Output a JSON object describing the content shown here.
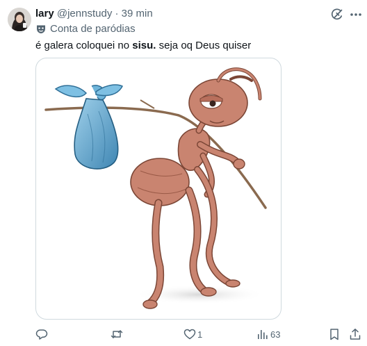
{
  "tweet": {
    "display_name": "lary",
    "handle": "@jennstudy",
    "separator": "·",
    "time": "39 min",
    "parody_label": "Conta de paródias",
    "text_before": "é galera coloquei no ",
    "text_bold": "sisu.",
    "text_after": " seja oq Deus quiser"
  },
  "actions": {
    "reply_count": "",
    "repost_count": "",
    "like_count": "1",
    "views_count": "63"
  },
  "icons": {
    "grok": "grok-icon",
    "more": "more-icon",
    "parody": "parody-mask-icon",
    "reply": "reply-icon",
    "repost": "repost-icon",
    "like": "heart-icon",
    "views": "views-icon",
    "bookmark": "bookmark-icon",
    "share": "share-icon"
  },
  "colors": {
    "text": "#0f1419",
    "secondary": "#536471",
    "border": "#cfd9de",
    "bundle": "#5aa6cf",
    "ant": "#c98470"
  }
}
